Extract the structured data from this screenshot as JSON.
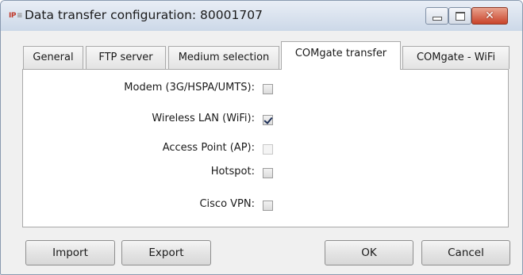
{
  "window": {
    "icon_text": "IP",
    "title": "Data transfer configuration: 80001707",
    "close_glyph": "✕"
  },
  "tabs": [
    {
      "label": "General",
      "active": false
    },
    {
      "label": "FTP server",
      "active": false
    },
    {
      "label": "Medium selection",
      "active": false
    },
    {
      "label": "COMgate transfer",
      "active": true
    },
    {
      "label": "COMgate - WiFi",
      "active": false
    }
  ],
  "options": [
    {
      "label": "Modem (3G/HSPA/UMTS):",
      "checked": false,
      "enabled": true
    },
    {
      "label": "Wireless LAN (WiFi):",
      "checked": true,
      "enabled": true
    },
    {
      "label": "Access Point (AP):",
      "checked": false,
      "enabled": false
    },
    {
      "label": "Hotspot:",
      "checked": false,
      "enabled": true
    },
    {
      "label": "Cisco VPN:",
      "checked": false,
      "enabled": true
    }
  ],
  "buttons": {
    "import": "Import",
    "export": "Export",
    "ok": "OK",
    "cancel": "Cancel"
  },
  "colors": {
    "close_button": "#c9432a",
    "panel_bg": "#ffffff",
    "window_bg": "#f0f0f0"
  }
}
